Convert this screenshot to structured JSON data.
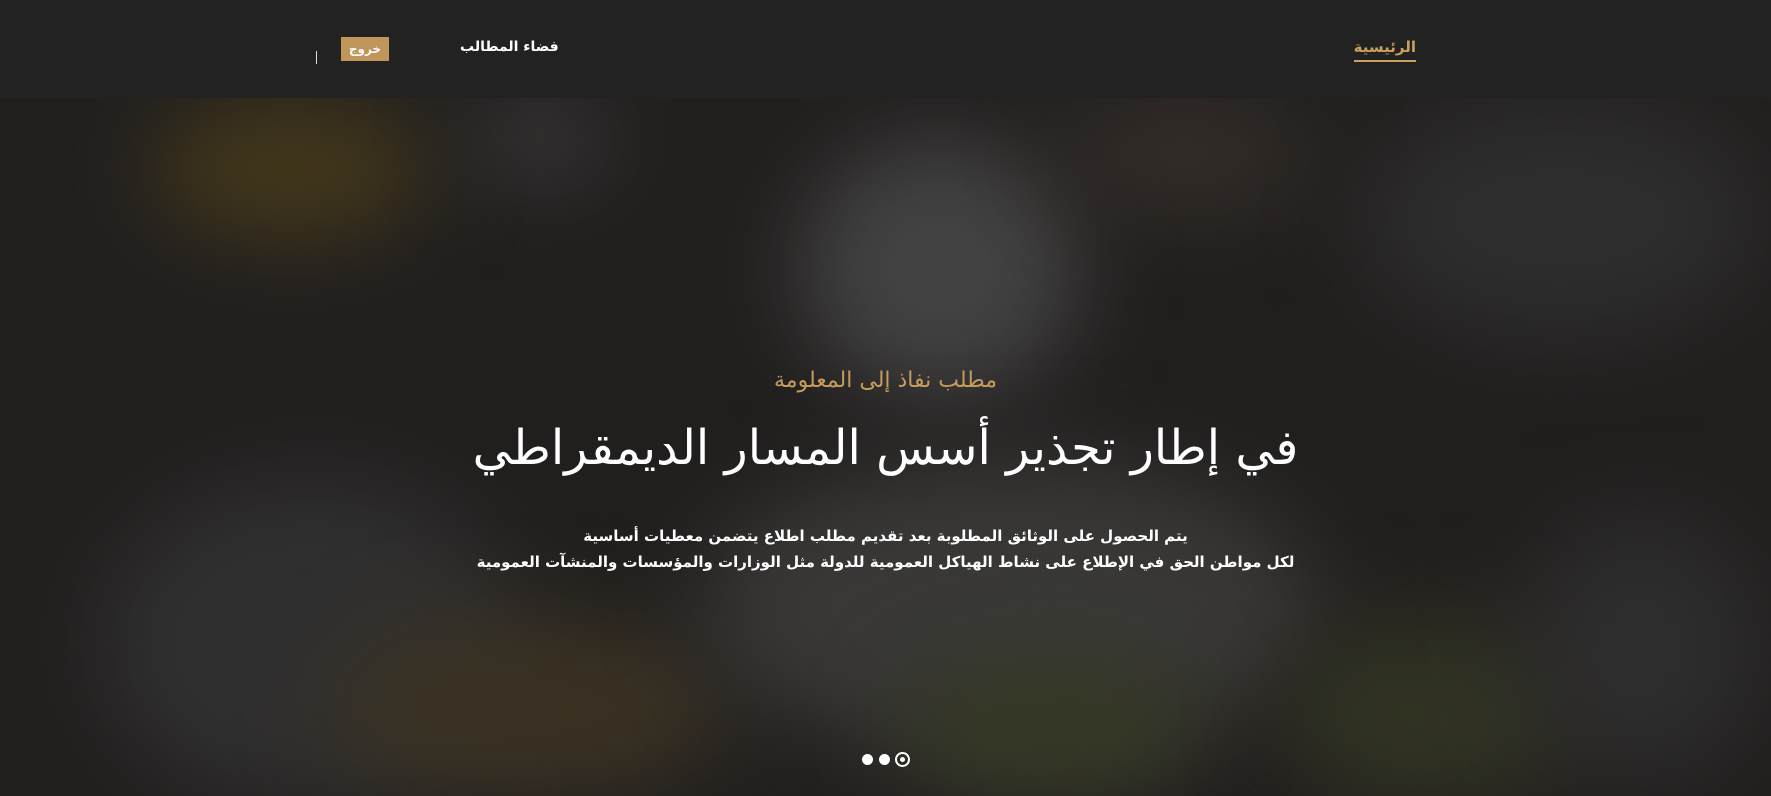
{
  "nav": {
    "home_label": "الرئيسية",
    "space_label": "فضاء المطالب",
    "logout_label": "خروج",
    "accent_color": "#c9a05e",
    "background_color": "#222222"
  },
  "hero": {
    "subtitle": "مطلب نفاذ إلى المعلومة",
    "title": "في إطار تجذير أسس المسار الديمقراطي",
    "desc_line1": "يتم الحصول على الوثائق المطلوبة بعد تقديم مطلب اطلاع يتضمن معطيات أساسية",
    "desc_line2": "لكل مواطن الحق في الإطلاع على نشاط الهياكل العمومية للدولة مثل الوزارات والمؤسسات والمنشآت العمومية"
  },
  "slider": {
    "dot_count": 3,
    "active_index": 2
  }
}
